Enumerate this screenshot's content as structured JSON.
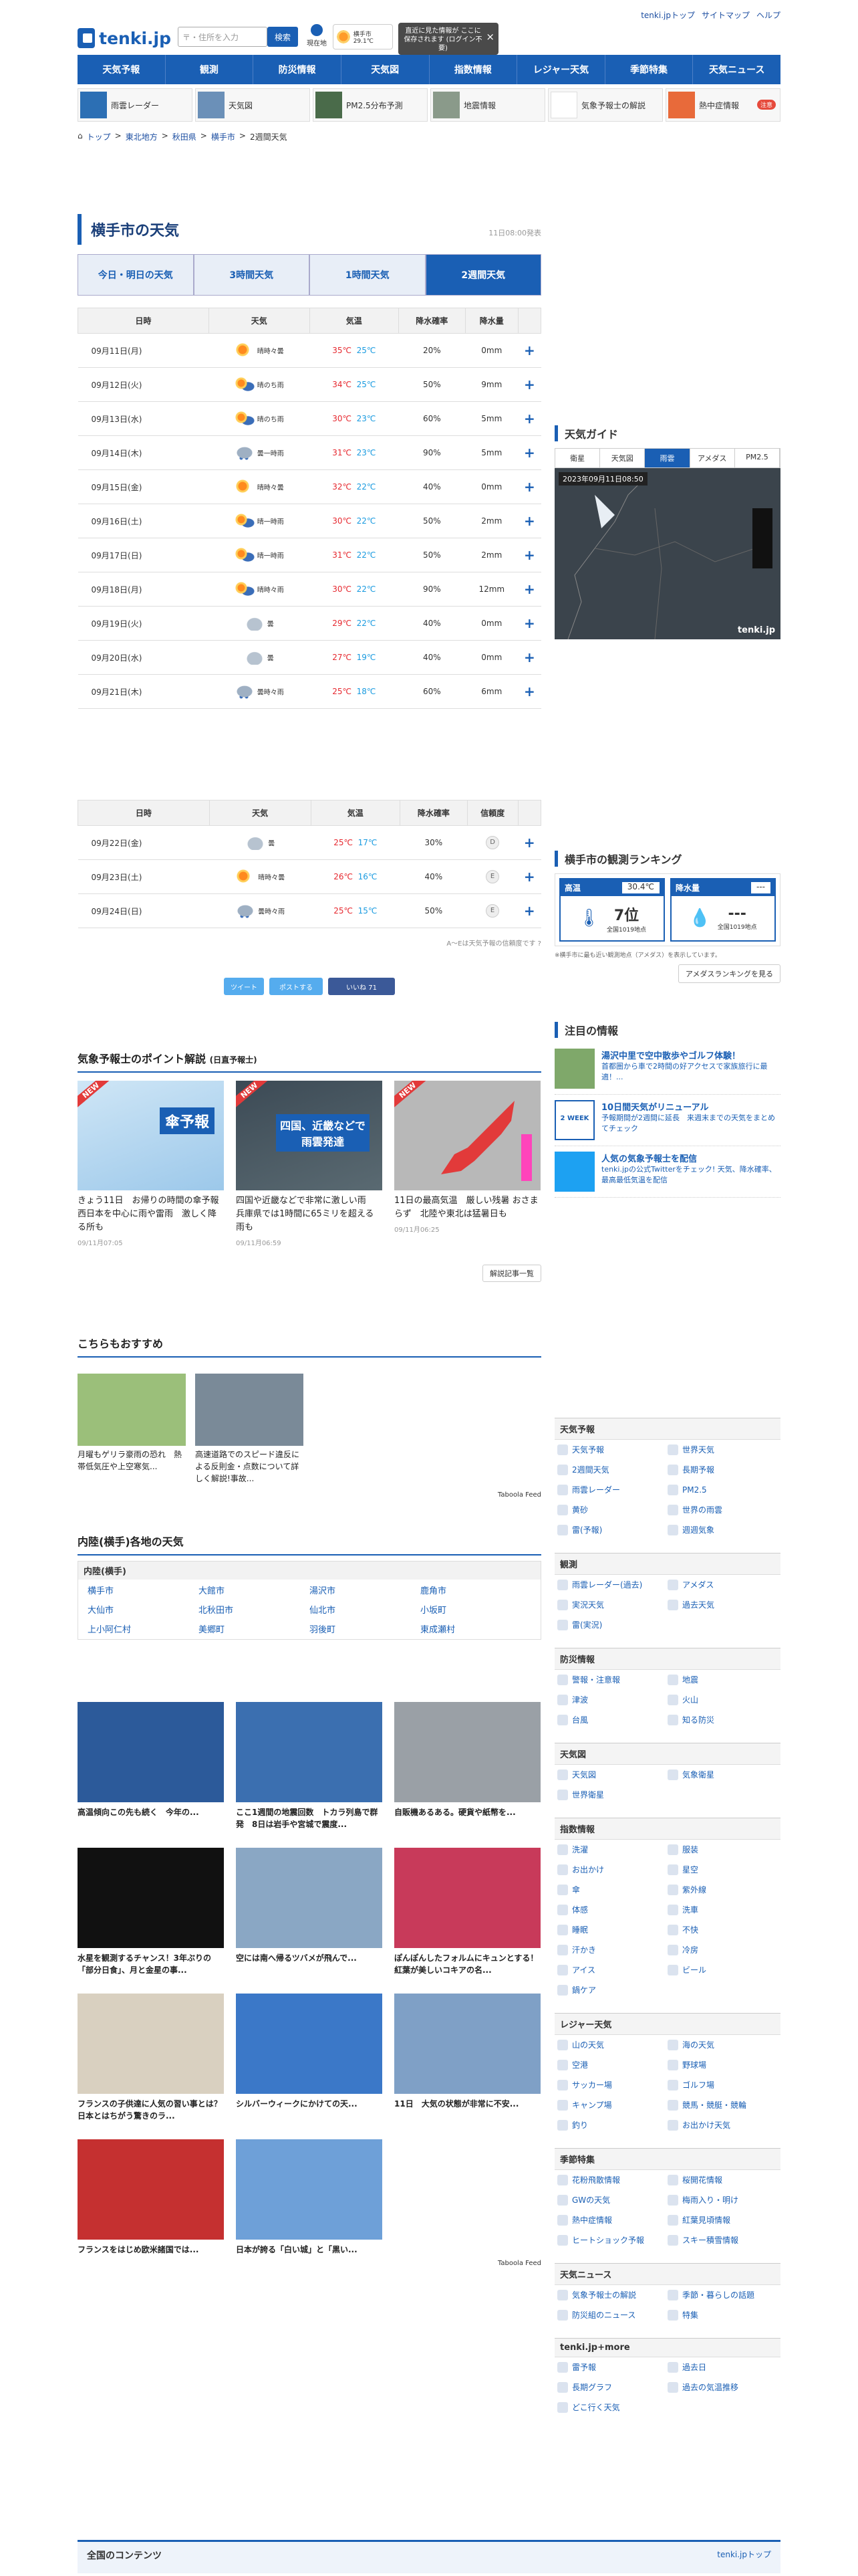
{
  "header": {
    "logo_text": "tenki.jp",
    "search_placeholder": "〒・住所を入力",
    "search_button": "検索",
    "location_label": "現在地",
    "mini_weather": "横手市 29.1℃",
    "tooltip": "直近に見た情報が ここに保存されます (ログイン不要)",
    "toplinks": [
      "tenki.jpトップ",
      "サイトマップ",
      "ヘルプ"
    ]
  },
  "gnav": [
    "天気予報",
    "観測",
    "防災情報",
    "天気図",
    "指数情報",
    "レジャー天気",
    "季節特集",
    "天気ニュース"
  ],
  "subnav": [
    {
      "label": "雨雲レーダー"
    },
    {
      "label": "天気図"
    },
    {
      "label": "PM2.5分布予測"
    },
    {
      "label": "地震情報"
    },
    {
      "label": "気象予報士の解説"
    },
    {
      "label": "熱中症情報",
      "badge": "注意"
    }
  ],
  "breadcrumb": [
    "トップ",
    "東北地方",
    "秋田県",
    "横手市",
    "2週間天気"
  ],
  "page": {
    "title": "横手市の天気",
    "timestamp": "11日08:00発表"
  },
  "tabs": [
    "今日・明日の天気",
    "3時間天気",
    "1時間天気",
    "2週間天気"
  ],
  "forecast": {
    "headers": [
      "日時",
      "天気",
      "気温",
      "降水確率",
      "降水量"
    ],
    "rows": [
      {
        "date": "09月11日(月)",
        "weather": "晴時々曇",
        "icon": "sun",
        "max": "35℃",
        "min": "25℃",
        "pop": "20%",
        "amt": "0mm",
        "day": ""
      },
      {
        "date": "09月12日(火)",
        "weather": "晴のち雨",
        "icon": "rain",
        "max": "34℃",
        "min": "25℃",
        "pop": "50%",
        "amt": "9mm",
        "day": ""
      },
      {
        "date": "09月13日(水)",
        "weather": "晴のち雨",
        "icon": "rain",
        "max": "30℃",
        "min": "23℃",
        "pop": "60%",
        "amt": "5mm",
        "day": ""
      },
      {
        "date": "09月14日(木)",
        "weather": "曇一時雨",
        "icon": "cloudrain",
        "max": "31℃",
        "min": "23℃",
        "pop": "90%",
        "amt": "5mm",
        "day": ""
      },
      {
        "date": "09月15日(金)",
        "weather": "晴時々曇",
        "icon": "sun",
        "max": "32℃",
        "min": "22℃",
        "pop": "40%",
        "amt": "0mm",
        "day": ""
      },
      {
        "date": "09月16日(土)",
        "weather": "晴一時雨",
        "icon": "rain",
        "max": "30℃",
        "min": "22℃",
        "pop": "50%",
        "amt": "2mm",
        "day": "sat"
      },
      {
        "date": "09月17日(日)",
        "weather": "晴一時雨",
        "icon": "rain",
        "max": "31℃",
        "min": "22℃",
        "pop": "50%",
        "amt": "2mm",
        "day": "sun"
      },
      {
        "date": "09月18日(月)",
        "weather": "晴時々雨",
        "icon": "rain",
        "max": "30℃",
        "min": "22℃",
        "pop": "90%",
        "amt": "12mm",
        "day": "sun"
      },
      {
        "date": "09月19日(火)",
        "weather": "曇",
        "icon": "cloud",
        "max": "29℃",
        "min": "22℃",
        "pop": "40%",
        "amt": "0mm",
        "day": ""
      },
      {
        "date": "09月20日(水)",
        "weather": "曇",
        "icon": "cloud",
        "max": "27℃",
        "min": "19℃",
        "pop": "40%",
        "amt": "0mm",
        "day": ""
      },
      {
        "date": "09月21日(木)",
        "weather": "曇時々雨",
        "icon": "cloudrain",
        "max": "25℃",
        "min": "18℃",
        "pop": "60%",
        "amt": "6mm",
        "day": ""
      }
    ]
  },
  "forecast2": {
    "headers": [
      "日時",
      "天気",
      "気温",
      "降水確率",
      "信頼度"
    ],
    "rows": [
      {
        "date": "09月22日(金)",
        "weather": "曇",
        "icon": "cloud",
        "max": "25℃",
        "min": "17℃",
        "pop": "30%",
        "rel": "D",
        "day": ""
      },
      {
        "date": "09月23日(土)",
        "weather": "晴時々曇",
        "icon": "sun",
        "max": "26℃",
        "min": "16℃",
        "pop": "40%",
        "rel": "E",
        "day": "sat"
      },
      {
        "date": "09月24日(日)",
        "weather": "曇時々雨",
        "icon": "cloudrain",
        "max": "25℃",
        "min": "15℃",
        "pop": "50%",
        "rel": "E",
        "day": "sun"
      }
    ],
    "note": "A〜Eは天気予報の信頼度です"
  },
  "share": {
    "tweet": "ツイート",
    "post": "ポストする",
    "like": "いいね 71"
  },
  "points": {
    "heading": "気象予報士のポイント解説",
    "sub": "(日直予報士)",
    "more": "解説記事一覧",
    "cards": [
      {
        "caption": "きょう11日　お帰りの時間の傘予報　西日本を中心に雨や雷雨　激しく降る所も",
        "date": "09/11月07:05",
        "img_text": "傘予報"
      },
      {
        "caption": "四国や近畿などで非常に激しい雨　兵庫県では1時間に65ミリを超える雨も",
        "date": "09/11月06:59",
        "img_text": "四国、近畿などで 雨雲発達"
      },
      {
        "caption": "11日の最高気温　厳しい残暑 おさまらず　北陸や東北は猛暑日も",
        "date": "09/11月06:25",
        "img_text": ""
      }
    ]
  },
  "reco": {
    "heading": "こちらもおすすめ",
    "items": [
      {
        "caption": "月曜もゲリラ豪雨の恐れ　熱帯低気圧や上空寒気..."
      },
      {
        "caption": "高速道路でのスピード違反による反則金・点数について詳しく解説!事故..."
      }
    ],
    "taboola": "Taboola Feed"
  },
  "area": {
    "heading": "内陸(横手)各地の天気",
    "sub": "内陸(横手)",
    "cities": [
      "横手市",
      "大館市",
      "湯沢市",
      "鹿角市",
      "大仙市",
      "北秋田市",
      "仙北市",
      "小坂町",
      "上小阿仁村",
      "美郷町",
      "羽後町",
      "東成瀬村"
    ]
  },
  "tb": {
    "items": [
      "高温傾向この先も続く　今年の...",
      "ここ1週間の地震回数　トカラ列島で群発　8日は岩手や宮城で震度...",
      "自販機あるある。硬貨や紙幣を...",
      "水星を観測するチャンス！3年ぶりの「部分日食」、月と金星の事...",
      "空には南へ帰るツバメが飛んで...",
      "ぽんぽんしたフォルムにキュンとする！紅葉が美しいコキアの名...",
      "フランスの子供達に人気の習い事とは？日本とはちがう驚きのラ...",
      "シルバーウィークにかけての天...",
      "11日　大気の状態が非常に不安...",
      "フランスをはじめ欧米諸国では...",
      "日本が誇る「白い城」と「黒い..."
    ],
    "taboola": "Taboola Feed"
  },
  "guide": {
    "heading": "天気ガイド",
    "tabs": [
      "衛星",
      "天気図",
      "雨雲",
      "アメダス",
      "PM2.5"
    ],
    "radar_time": "2023年09月11日08:50",
    "radar_logo": "tenki.jp"
  },
  "ranking": {
    "heading": "横手市の観測ランキング",
    "high_label": "高温",
    "high_value": "30.4℃",
    "high_rank": "7位",
    "high_sub": "全国1019地点",
    "rain_label": "降水量",
    "rain_value": "---",
    "rain_rank": "---",
    "rain_sub": "全国1019地点",
    "note": "※横手市に最も近い観測地点（アメダス）を表示しています。",
    "link": "アメダスランキングを見る"
  },
  "notices": {
    "heading": "注目の情報",
    "items": [
      {
        "title": "湯沢中里で空中散歩やゴルフ体験！",
        "desc": "首都圏から車で2時間の好アクセスで家族旅行に最適！..."
      },
      {
        "title": "10日間天気がリニューアル",
        "desc": "予報期間が2週間に延長　来週末までの天気をまとめてチェック"
      },
      {
        "title": "人気の気象予報士を配信",
        "desc": "tenki.jpの公式Twitterをチェック! 天気、降水確率、最高最低気温を配信"
      }
    ],
    "cal_text": "2 WEEK"
  },
  "sidemenu": [
    {
      "h": "天気予報",
      "items": [
        "天気予報",
        "世界天気",
        "2週間天気",
        "長期予報",
        "雨雲レーダー",
        "PM2.5",
        "黄砂",
        "世界の雨雲",
        "雷(予報)",
        "週週気象"
      ]
    },
    {
      "h": "観測",
      "items": [
        "雨雲レーダー(過去)",
        "アメダス",
        "実況天気",
        "過去天気",
        "雷(実況)"
      ]
    },
    {
      "h": "防災情報",
      "items": [
        "警報・注意報",
        "地震",
        "津波",
        "火山",
        "台風",
        "知る防災"
      ]
    },
    {
      "h": "天気図",
      "items": [
        "天気図",
        "気象衛星",
        "世界衛星"
      ]
    },
    {
      "h": "指数情報",
      "items": [
        "洗濯",
        "服装",
        "お出かけ",
        "星空",
        "傘",
        "紫外線",
        "体感",
        "洗車",
        "睡眠",
        "不快",
        "汗かき",
        "冷房",
        "アイス",
        "ビール",
        "鍋ケア"
      ]
    },
    {
      "h": "レジャー天気",
      "items": [
        "山の天気",
        "海の天気",
        "空港",
        "野球場",
        "サッカー場",
        "ゴルフ場",
        "キャンプ場",
        "競馬・競艇・競輪",
        "釣り",
        "お出かけ天気"
      ]
    },
    {
      "h": "季節特集",
      "items": [
        "花粉飛散情報",
        "桜開花情報",
        "GWの天気",
        "梅雨入り・明け",
        "熱中症情報",
        "紅葉見頃情報",
        "ヒートショック予報",
        "スキー積雪情報"
      ]
    },
    {
      "h": "天気ニュース",
      "items": [
        "気象予報士の解説",
        "季節・暮らしの話題",
        "防災組のニュース",
        "特集"
      ]
    },
    {
      "h": "tenki.jp+more",
      "items": [
        "雷予報",
        "過去日",
        "長期グラフ",
        "過去の気温推移",
        "どこ行く天気"
      ]
    }
  ],
  "footer": {
    "heading": "全国のコンテンツ",
    "link": "tenki.jpトップ"
  }
}
